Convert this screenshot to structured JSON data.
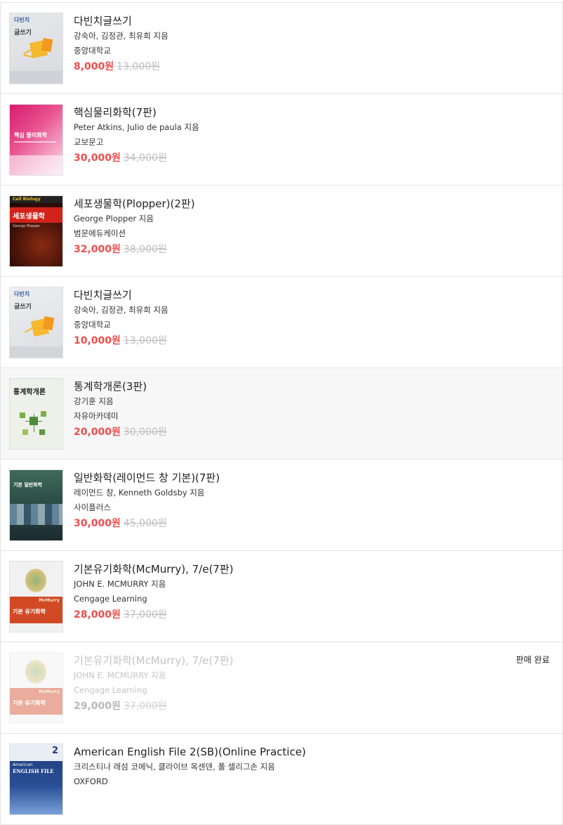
{
  "books": [
    {
      "title": "다빈치글쓰기",
      "author": "강숙아, 김정관, 최유희 지음",
      "publisher": "중앙대학교",
      "price": "8,000원",
      "original_price": "13,000원",
      "cover_texts": [
        "다빈치",
        "글쓰기"
      ]
    },
    {
      "title": "핵심물리화학(7판)",
      "author": "Peter Atkins, Julio de paula 지음",
      "publisher": "교보문고",
      "price": "30,000원",
      "original_price": "34,000원",
      "cover_texts": [
        "핵심 물리화학"
      ]
    },
    {
      "title": "세포생물학(Plopper)(2판)",
      "author": "George Plopper 지음",
      "publisher": "범문에듀케이션",
      "price": "32,000원",
      "original_price": "38,000원",
      "cover_texts": [
        "Cell Biology",
        "세포생물학",
        "George Plopper"
      ]
    },
    {
      "title": "다빈치글쓰기",
      "author": "강숙아, 김정관, 최유희 지음",
      "publisher": "중앙대학교",
      "price": "10,000원",
      "original_price": "13,000원",
      "cover_texts": [
        "다빈치",
        "글쓰기"
      ]
    },
    {
      "title": "통계학개론(3판)",
      "author": "강기훈 지음",
      "publisher": "자유아카데미",
      "price": "20,000원",
      "original_price": "30,000원",
      "cover_texts": [
        "통계학개론"
      ]
    },
    {
      "title": "일반화학(레이먼드 창 기본)(7판)",
      "author": "레이먼드 창, Kenneth Goldsby 지음",
      "publisher": "사이플러스",
      "price": "30,000원",
      "original_price": "45,000원",
      "cover_texts": [
        "기본 일반화학"
      ]
    },
    {
      "title": "기본유기화학(McMurry), 7/e(7판)",
      "author": "JOHN E. MCMURRY 지음",
      "publisher": "Cengage Learning",
      "price": "28,000원",
      "original_price": "37,000원",
      "cover_texts": [
        "McMurry",
        "기본 유기화학"
      ]
    },
    {
      "title": "기본유기화학(McMurry), 7/e(7판)",
      "author": "JOHN E. MCMURRY 지음",
      "publisher": "Cengage Learning",
      "price": "29,000원",
      "original_price": "37,000원",
      "status": "판매 완료",
      "cover_texts": [
        "McMurry",
        "기본 유기화학"
      ]
    },
    {
      "title": "American English File 2(SB)(Online Practice)",
      "author": "크리스티나 래섬 코에닉, 클라이브 옥센덴, 폴 셀리그손 지음",
      "publisher": "OXFORD",
      "cover_texts": [
        "2",
        "American",
        "ENGLISH FILE"
      ]
    }
  ],
  "colors": {
    "price": "#ef4c4c",
    "strike": "#bdbdbd",
    "border": "#e5e5e5"
  },
  "icons": []
}
